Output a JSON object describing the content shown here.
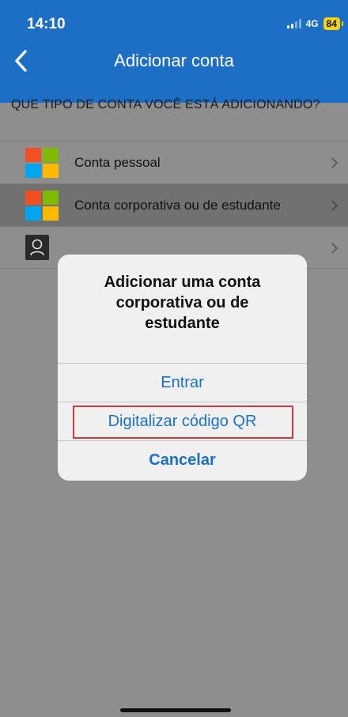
{
  "status_bar": {
    "time": "14:10",
    "network": "4G",
    "battery": "84"
  },
  "nav": {
    "title": "Adicionar conta"
  },
  "list": {
    "section_header": "QUE TIPO DE CONTA VOCÊ ESTÁ ADICIONANDO?",
    "items": [
      {
        "label": "Conta pessoal",
        "icon": "microsoft-logo-icon"
      },
      {
        "label": "Conta corporativa ou de estudante",
        "icon": "microsoft-logo-icon",
        "selected": true
      },
      {
        "label": "",
        "icon": "person-icon"
      }
    ]
  },
  "dialog": {
    "title": "Adicionar uma conta corporativa ou de estudante",
    "actions": [
      "Entrar",
      "Digitalizar código QR",
      "Cancelar"
    ]
  },
  "colors": {
    "header": "#1d6ec5",
    "accent": "#1a70c9",
    "highlight_frame": "#d0393b",
    "ms_red": "#f25022",
    "ms_green": "#7fba00",
    "ms_blue": "#00a4ef",
    "ms_yellow": "#ffb900"
  }
}
